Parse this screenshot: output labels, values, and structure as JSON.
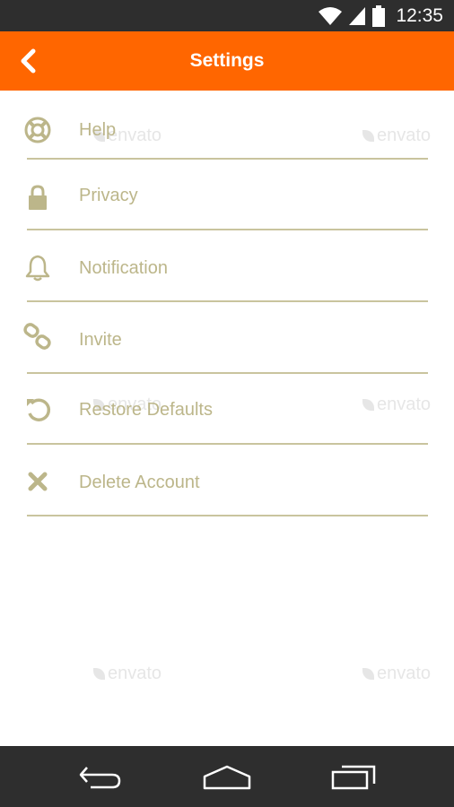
{
  "status_bar": {
    "time": "12:35",
    "icons": [
      "wifi-icon",
      "signal-icon",
      "battery-icon"
    ]
  },
  "app_bar": {
    "title": "Settings",
    "back_icon": "chevron-left-icon",
    "color": "#ff6600"
  },
  "settings": {
    "items": [
      {
        "label": "Help",
        "icon": "lifebuoy-icon"
      },
      {
        "label": "Privacy",
        "icon": "lock-icon"
      },
      {
        "label": "Notification",
        "icon": "bell-icon"
      },
      {
        "label": "Invite",
        "icon": "chain-link-icon"
      },
      {
        "label": "Restore Defaults",
        "icon": "restore-icon"
      },
      {
        "label": "Delete Account",
        "icon": "close-x-icon"
      }
    ],
    "label_color": "#bcb68a"
  },
  "watermark": {
    "text": "envato"
  },
  "nav_bar": {
    "buttons": [
      "back-icon",
      "home-icon",
      "recent-apps-icon"
    ]
  }
}
